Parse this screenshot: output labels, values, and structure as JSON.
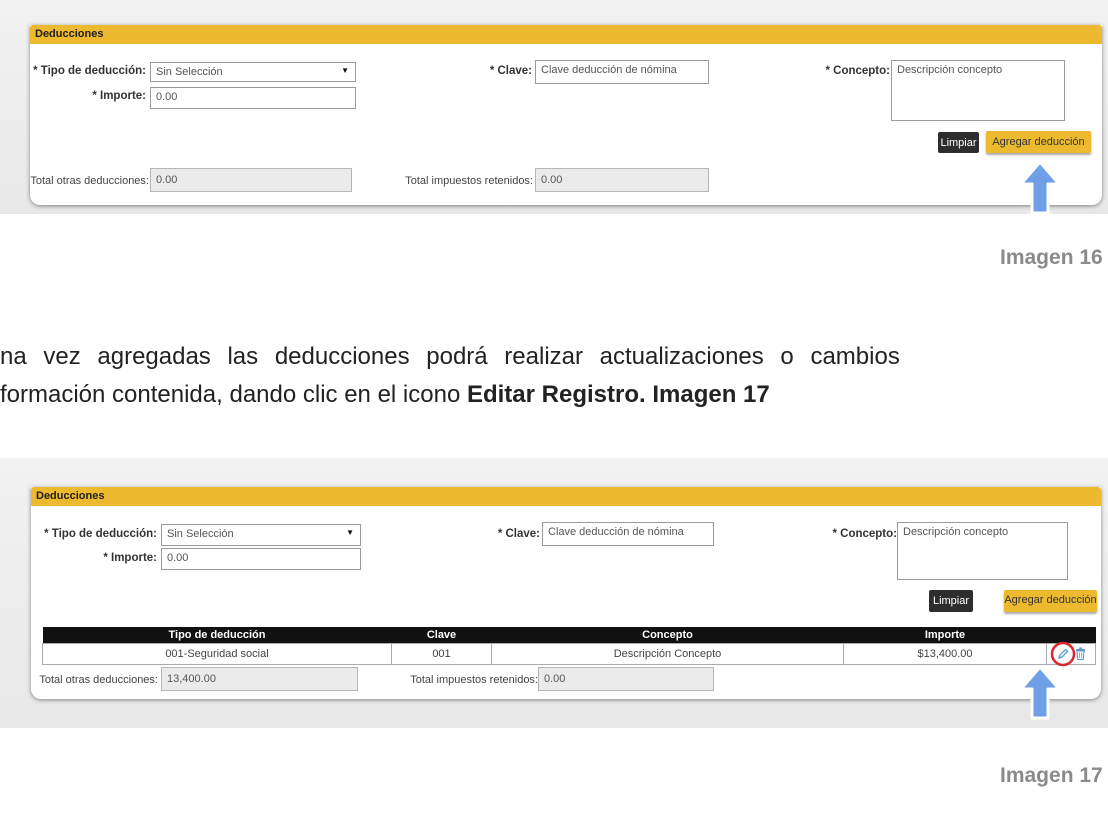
{
  "panel1": {
    "title": "Deducciones",
    "tipo_label": "* Tipo de deducción:",
    "tipo_value": "Sin Selección",
    "importe_label": "* Importe:",
    "importe_value": "0.00",
    "clave_label": "* Clave:",
    "clave_placeholder": "Clave deducción de nómina",
    "concepto_label": "* Concepto:",
    "concepto_placeholder": "Descripción concepto",
    "limpiar": "Limpiar",
    "agregar": "Agregar deducción",
    "total_otras_label": "Total otras deducciones:",
    "total_otras_value": "0.00",
    "total_impuestos_label": "Total impuestos retenidos:",
    "total_impuestos_value": "0.00"
  },
  "caption1": "Imagen 16",
  "paragraph": {
    "line1": "na vez agregadas las deducciones podrá realizar actualizaciones o cambios",
    "line2_normal": "formación contenida, dando clic en el icono ",
    "line2_bold": "Editar Registro. Imagen 17"
  },
  "panel2": {
    "title": "Deducciones",
    "tipo_label": "* Tipo de deducción:",
    "tipo_value": "Sin Selección",
    "importe_label": "* Importe:",
    "importe_value": "0.00",
    "clave_label": "* Clave:",
    "clave_placeholder": "Clave deducción de nómina",
    "concepto_label": "* Concepto:",
    "concepto_placeholder": "Descripción concepto",
    "limpiar": "Limpiar",
    "agregar": "Agregar deducción",
    "table": {
      "headers": [
        "Tipo de deducción",
        "Clave",
        "Concepto",
        "Importe"
      ],
      "rows": [
        [
          "001-Seguridad social",
          "001",
          "Descripción Concepto",
          "$13,400.00"
        ]
      ]
    },
    "total_otras_label": "Total otras deducciones:",
    "total_otras_value": "13,400.00",
    "total_impuestos_label": "Total impuestos retenidos:",
    "total_impuestos_value": "0.00"
  },
  "caption2": "Imagen 17",
  "colors": {
    "accent": "#ecb92f",
    "arrow": "#6f9fe6",
    "highlight_circle": "#d9262f"
  },
  "icons": {
    "select": "chevron-down-icon",
    "edit": "pencil-icon",
    "delete": "trash-icon",
    "pointer": "up-arrow-icon"
  }
}
